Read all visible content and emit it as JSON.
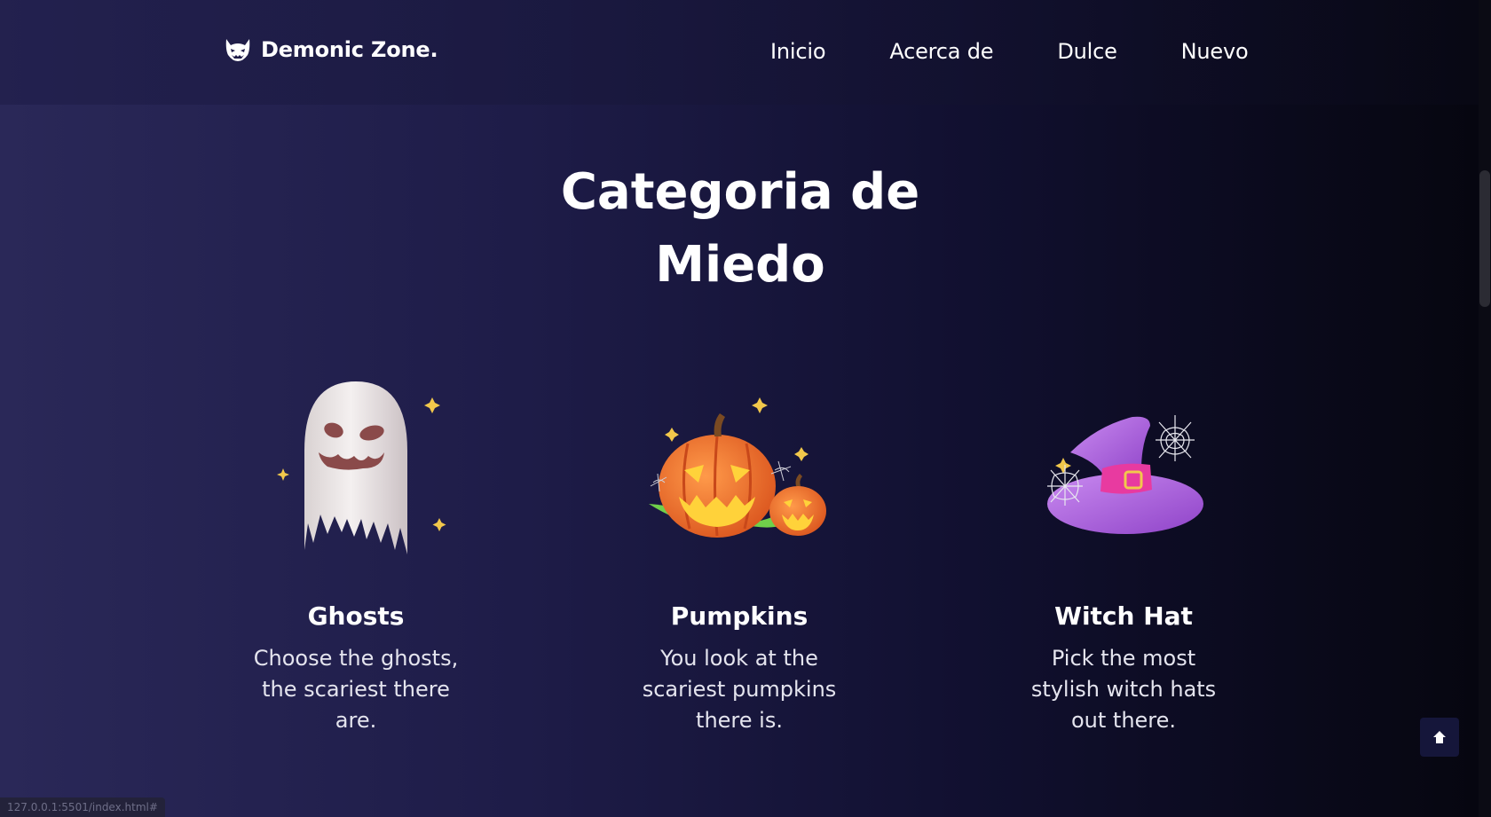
{
  "header": {
    "logo_text": "Demonic Zone.",
    "nav": [
      {
        "label": "Inicio"
      },
      {
        "label": "Acerca de"
      },
      {
        "label": "Dulce"
      },
      {
        "label": "Nuevo"
      }
    ]
  },
  "section": {
    "title_line1": "Categoria de",
    "title_line2": "Miedo"
  },
  "cards": [
    {
      "icon": "ghost-icon",
      "title": "Ghosts",
      "description": "Choose the ghosts, the scariest there are."
    },
    {
      "icon": "pumpkin-icon",
      "title": "Pumpkins",
      "description": "You look at the scariest pumpkins there is."
    },
    {
      "icon": "witch-hat-icon",
      "title": "Witch Hat",
      "description": "Pick the most stylish witch hats out there."
    }
  ],
  "status_bar": {
    "url": "127.0.0.1:5501/index.html#"
  },
  "colors": {
    "background_left": "#2a2858",
    "background_right": "#06060f",
    "pumpkin": "#f07a2a",
    "witch_hat": "#b066e0",
    "hat_band": "#e83aa0",
    "ghost": "#ece6e6"
  }
}
